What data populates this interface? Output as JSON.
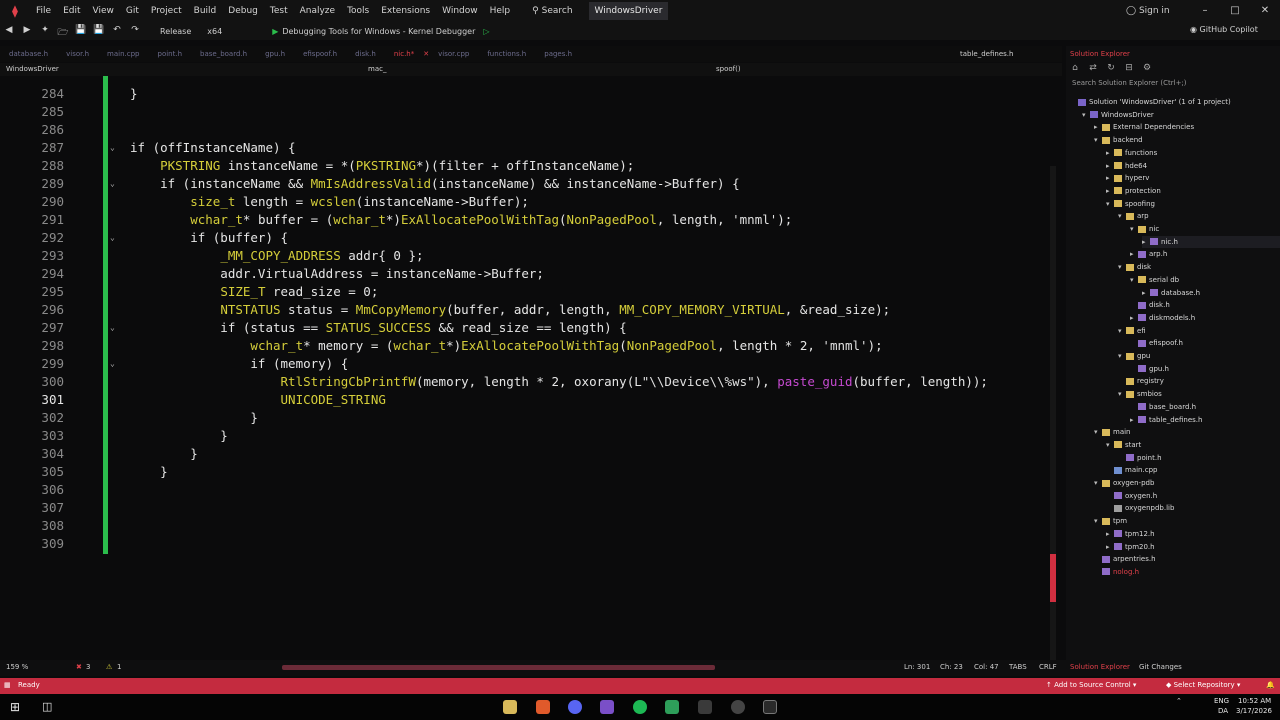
{
  "menubar": {
    "items": [
      "File",
      "Edit",
      "View",
      "Git",
      "Project",
      "Build",
      "Debug",
      "Test",
      "Analyze",
      "Tools",
      "Extensions",
      "Window",
      "Help"
    ],
    "search": "Search",
    "solution": "WindowsDriver",
    "sign_in": "Sign in"
  },
  "toolbar": {
    "config": "Release",
    "platform": "x64",
    "debugger": "Debugging Tools for Windows - Kernel Debugger",
    "copilot": "GitHub Copilot"
  },
  "tabs": [
    "database.h",
    "visor.h",
    "main.cpp",
    "point.h",
    "base_board.h",
    "gpu.h",
    "efispoof.h",
    "disk.h",
    "nic.h*",
    "visor.cpp",
    "functions.h",
    "pages.h"
  ],
  "active_tab": "nic.h*",
  "right_tab": "table_defines.h",
  "navbar": {
    "project": "WindowsDriver",
    "scope": "mac_",
    "function": "spoof()"
  },
  "editor": {
    "lines": [
      {
        "n": "284",
        "code": "}"
      },
      {
        "n": "285",
        "code": ""
      },
      {
        "n": "286",
        "code": ""
      },
      {
        "n": "287",
        "code": "if (offInstanceName) {"
      },
      {
        "n": "288",
        "code": "    PKSTRING instanceName = *(PKSTRING*)(filter + offInstanceName);"
      },
      {
        "n": "289",
        "code": "    if (instanceName && MmIsAddressValid(instanceName) && instanceName->Buffer) {"
      },
      {
        "n": "290",
        "code": "        size_t length = wcslen(instanceName->Buffer);"
      },
      {
        "n": "291",
        "code": "        wchar_t* buffer = (wchar_t*)ExAllocatePoolWithTag(NonPagedPool, length, 'mnml');"
      },
      {
        "n": "292",
        "code": "        if (buffer) {"
      },
      {
        "n": "293",
        "code": "            _MM_COPY_ADDRESS addr{ 0 };"
      },
      {
        "n": "294",
        "code": "            addr.VirtualAddress = instanceName->Buffer;"
      },
      {
        "n": "295",
        "code": "            SIZE_T read_size = 0;"
      },
      {
        "n": "296",
        "code": "            NTSTATUS status = MmCopyMemory(buffer, addr, length, MM_COPY_MEMORY_VIRTUAL, &read_size);"
      },
      {
        "n": "297",
        "code": "            if (status == STATUS_SUCCESS && read_size == length) {"
      },
      {
        "n": "298",
        "code": "                wchar_t* memory = (wchar_t*)ExAllocatePoolWithTag(NonPagedPool, length * 2, 'mnml');"
      },
      {
        "n": "299",
        "code": "                if (memory) {"
      },
      {
        "n": "300",
        "code": "                    RtlStringCbPrintfW(memory, length * 2, oxorany(L\"\\\\Device\\\\%ws\"), paste_guid(buffer, length));"
      },
      {
        "n": "301",
        "code": "                    UNICODE_STRING"
      },
      {
        "n": "302",
        "code": "                }"
      },
      {
        "n": "303",
        "code": "            }"
      },
      {
        "n": "304",
        "code": "        }"
      },
      {
        "n": "305",
        "code": "    }"
      },
      {
        "n": "306",
        "code": ""
      },
      {
        "n": "307",
        "code": ""
      },
      {
        "n": "308",
        "code": ""
      },
      {
        "n": "309",
        "code": ""
      }
    ],
    "current_line": "301"
  },
  "solution_explorer": {
    "title": "Solution Explorer",
    "search_placeholder": "Search Solution Explorer (Ctrl+;)",
    "items": [
      {
        "label": "Solution 'WindowsDriver' (1 of 1 project)",
        "depth": 0,
        "icon": "solution",
        "exp": ""
      },
      {
        "label": "WindowsDriver",
        "depth": 1,
        "icon": "proj",
        "exp": "v"
      },
      {
        "label": "External Dependencies",
        "depth": 2,
        "icon": "folder",
        "exp": ">"
      },
      {
        "label": "backend",
        "depth": 2,
        "icon": "folder",
        "exp": "v"
      },
      {
        "label": "functions",
        "depth": 3,
        "icon": "folder",
        "exp": ">"
      },
      {
        "label": "hde64",
        "depth": 3,
        "icon": "folder",
        "exp": ">"
      },
      {
        "label": "hyperv",
        "depth": 3,
        "icon": "folder",
        "exp": ">"
      },
      {
        "label": "protection",
        "depth": 3,
        "icon": "folder",
        "exp": ">"
      },
      {
        "label": "spoofing",
        "depth": 3,
        "icon": "folder",
        "exp": "v"
      },
      {
        "label": "arp",
        "depth": 4,
        "icon": "folder",
        "exp": "v"
      },
      {
        "label": "nic",
        "depth": 5,
        "icon": "folder",
        "exp": "v"
      },
      {
        "label": "nic.h",
        "depth": 6,
        "icon": "hfile",
        "exp": ">"
      },
      {
        "label": "arp.h",
        "depth": 5,
        "icon": "hfile",
        "exp": ">"
      },
      {
        "label": "disk",
        "depth": 4,
        "icon": "folder",
        "exp": "v"
      },
      {
        "label": "serial db",
        "depth": 5,
        "icon": "folder",
        "exp": "v"
      },
      {
        "label": "database.h",
        "depth": 6,
        "icon": "hfile",
        "exp": ">"
      },
      {
        "label": "disk.h",
        "depth": 5,
        "icon": "hfile",
        "exp": ""
      },
      {
        "label": "diskmodels.h",
        "depth": 5,
        "icon": "hfile",
        "exp": ">"
      },
      {
        "label": "efi",
        "depth": 4,
        "icon": "folder",
        "exp": "v"
      },
      {
        "label": "efispoof.h",
        "depth": 5,
        "icon": "hfile",
        "exp": ""
      },
      {
        "label": "gpu",
        "depth": 4,
        "icon": "folder",
        "exp": "v"
      },
      {
        "label": "gpu.h",
        "depth": 5,
        "icon": "hfile",
        "exp": ""
      },
      {
        "label": "registry",
        "depth": 4,
        "icon": "folder",
        "exp": ""
      },
      {
        "label": "smbios",
        "depth": 4,
        "icon": "folder",
        "exp": "v"
      },
      {
        "label": "base_board.h",
        "depth": 5,
        "icon": "hfile",
        "exp": ""
      },
      {
        "label": "table_defines.h",
        "depth": 5,
        "icon": "hfile",
        "exp": ">"
      },
      {
        "label": "main",
        "depth": 2,
        "icon": "folder",
        "exp": "v"
      },
      {
        "label": "start",
        "depth": 3,
        "icon": "folder",
        "exp": "v"
      },
      {
        "label": "point.h",
        "depth": 4,
        "icon": "hfile",
        "exp": ""
      },
      {
        "label": "main.cpp",
        "depth": 3,
        "icon": "cppfile",
        "exp": ""
      },
      {
        "label": "oxygen-pdb",
        "depth": 2,
        "icon": "folder",
        "exp": "v"
      },
      {
        "label": "oxygen.h",
        "depth": 3,
        "icon": "hfile",
        "exp": ""
      },
      {
        "label": "oxygenpdb.lib",
        "depth": 3,
        "icon": "libfile",
        "exp": ""
      },
      {
        "label": "tpm",
        "depth": 2,
        "icon": "folder",
        "exp": "v"
      },
      {
        "label": "tpm12.h",
        "depth": 3,
        "icon": "hfile",
        "exp": ">"
      },
      {
        "label": "tpm20.h",
        "depth": 3,
        "icon": "hfile",
        "exp": ">"
      },
      {
        "label": "arpentries.h",
        "depth": 2,
        "icon": "hfile",
        "exp": ""
      },
      {
        "label": "nolog.h",
        "depth": 2,
        "icon": "hfile",
        "exp": ""
      }
    ]
  },
  "editor_status": {
    "zoom": "159 %",
    "errors": "3",
    "warnings": "1",
    "ln": "Ln: 301",
    "ch": "Ch: 23",
    "col": "Col: 47",
    "tabs": "TABS",
    "eol": "CRLF",
    "se_tab": "Solution Explorer",
    "git_tab": "Git Changes"
  },
  "status": {
    "ready": "Ready",
    "add_source": "Add to Source Control",
    "select_repo": "Select Repository"
  },
  "taskbar": {
    "lang1": "ENG",
    "lang2": "DA",
    "time": "10:52 AM",
    "date": "3/17/2026"
  }
}
